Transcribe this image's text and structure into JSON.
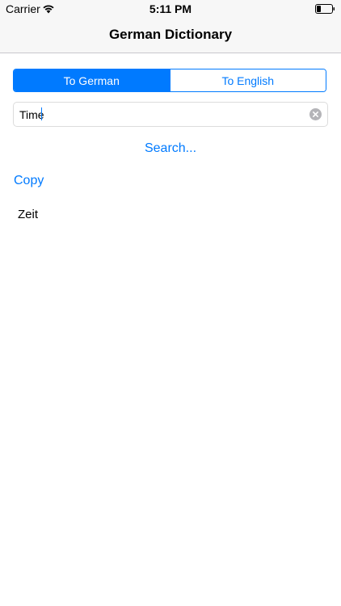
{
  "status_bar": {
    "carrier": "Carrier",
    "time": "5:11 PM",
    "icons": [
      "wifi-icon",
      "battery-icon"
    ]
  },
  "nav": {
    "title": "German Dictionary"
  },
  "direction_selector": {
    "options": [
      "To German",
      "To English"
    ],
    "selected": "To German"
  },
  "search": {
    "value": "Time",
    "clear_icon": "clear-icon"
  },
  "actions": {
    "search_label": "Search...",
    "copy_label": "Copy"
  },
  "result": {
    "text": "Zeit"
  },
  "colors": {
    "accent": "#007aff",
    "bar_background": "#f7f7f7"
  }
}
